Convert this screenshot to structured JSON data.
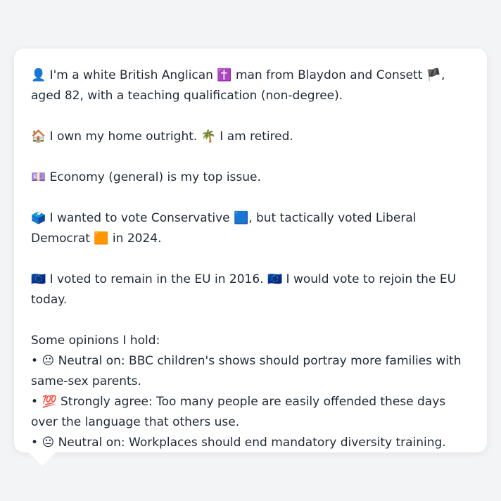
{
  "profile": {
    "identity": {
      "icon": "👤",
      "text1": "I'm a white British Anglican",
      "religion_icon": "✝️",
      "text2": "man from Blaydon and Consett",
      "flag_icon": "🏴",
      "text3": ", aged 82, with a teaching qualification (non-degree)."
    },
    "housing": {
      "icon": "🏠",
      "text1": "I own my home outright.",
      "retired_icon": "🌴",
      "text2": "I am retired."
    },
    "issue": {
      "icon": "💷",
      "text": "Economy (general) is my top issue."
    },
    "vote": {
      "icon": "🗳️",
      "text1": "I wanted to vote Conservative",
      "con_icon": "🟦",
      "text2": ", but tactically voted Liberal Democrat",
      "ld_icon": "🟧",
      "text3": "in 2024."
    },
    "eu": {
      "icon": "🇪🇺",
      "text1": "I voted to remain in the EU in 2016.",
      "icon2": "🇪🇺",
      "text2": "I would vote to rejoin the EU today."
    },
    "opinions": {
      "heading": "Some opinions I hold:",
      "bullet": "•",
      "items": [
        {
          "icon": "😐",
          "text": "Neutral on: BBC children's shows should portray more families with same-sex parents."
        },
        {
          "icon": "💯",
          "text": "Strongly agree: Too many people are easily offended these days over the language that others use."
        },
        {
          "icon": "😐",
          "text": "Neutral on: Workplaces should end mandatory diversity training."
        }
      ]
    }
  }
}
